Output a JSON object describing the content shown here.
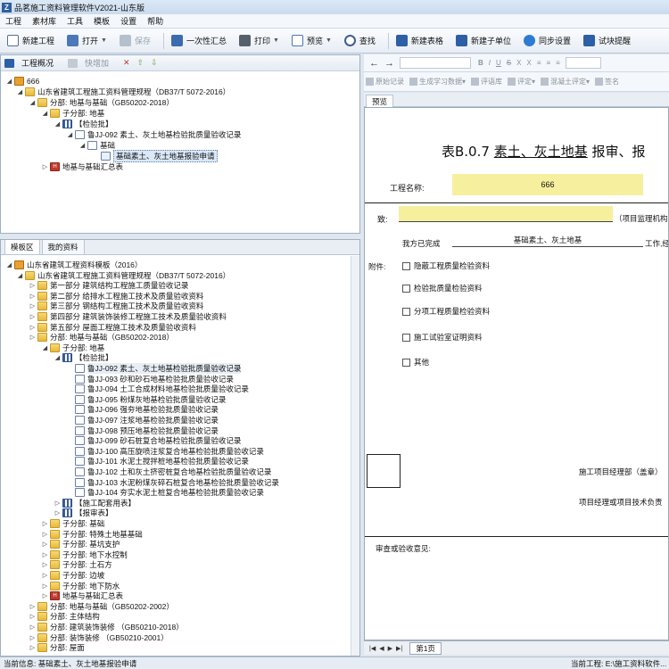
{
  "app": {
    "title": "品茗施工资料管理软件V2021-山东版"
  },
  "menu": [
    "工程",
    "素材库",
    "工具",
    "模板",
    "设置",
    "帮助"
  ],
  "toolbar": {
    "new_project": "新建工程",
    "open": "打开",
    "save": "保存",
    "summary": "一次性汇总",
    "print": "打印",
    "preview": "预览",
    "search": "查找",
    "new_table": "新建表格",
    "new_subunit": "新建子单位",
    "sync": "同步设置",
    "trial": "试块提醒"
  },
  "project_panel": {
    "title": "工程概况",
    "quick_add": "快增加",
    "tree": [
      "666",
      "山东省建筑工程施工资料管理规程（DB37/T 5072-2016）",
      "分部: 地基与基础（GB50202-2018）",
      "子分部: 地基",
      "【检验批】",
      "鲁JJ-092 素土、灰土地基检验批质量验收记录",
      "基础",
      "基础素土、灰土地基报验申请",
      "地基与基础汇总表"
    ]
  },
  "template_panel": {
    "tabs": [
      "模板区",
      "我的资料"
    ],
    "tree": [
      "山东省建筑工程资料模板（2016）",
      "山东省建筑工程施工资料管理规程（DB37/T 5072-2016）",
      "第一部分  建筑结构工程施工质量验收记录",
      "第二部分  给排水工程施工技术及质量验收资料",
      "第三部分  钢结构工程施工技术及质量验收资料",
      "第四部分  建筑装饰装修工程施工技术及质量验收资料",
      "第五部分  屋面工程施工技术及质量验收资料",
      "分部: 地基与基础（GB50202-2018）",
      "子分部: 地基",
      "【检验批】",
      "鲁JJ-092 素土、灰土地基检验批质量验收记录",
      "鲁JJ-093 砂和砂石地基检验批质量验收记录",
      "鲁JJ-094 土工合成材料地基检验批质量验收记录",
      "鲁JJ-095 粉煤灰地基检验批质量验收记录",
      "鲁JJ-096 强夯地基检验批质量验收记录",
      "鲁JJ-097 注浆地基检验批质量验收记录",
      "鲁JJ-098 预压地基检验批质量验收记录",
      "鲁JJ-099 砂石桩复合地基检验批质量验收记录",
      "鲁JJ-100 高压旋喷注浆复合地基检验批质量验收记录",
      "鲁JJ-101 水泥土搅拌桩地基检验批质量验收记录",
      "鲁JJ-102 土和灰土挤密桩复合地基检验批质量验收记录",
      "鲁JJ-103 水泥粉煤灰碎石桩复合地基检验批质量验收记录",
      "鲁JJ-104 夯实水泥土桩复合地基检验批质量验收记录",
      "【施工配套用表】",
      "【报审表】",
      "子分部: 基础",
      "子分部: 特殊土地基基础",
      "子分部: 基坑支护",
      "子分部: 地下水控制",
      "子分部: 土石方",
      "子分部: 边坡",
      "子分部: 地下防水",
      "地基与基础汇总表",
      "分部: 地基与基础（GB50202-2002）",
      "分部: 主体结构",
      "分部: 建筑装饰装修  （GB50210-2018）",
      "分部: 装饰装修  （GB50210-2001）",
      "分部: 屋面"
    ]
  },
  "doc_toolbar": {
    "items": [
      "原始记录",
      "生成学习数据",
      "评语库",
      "评定",
      "混凝土评定",
      "签名"
    ],
    "format": [
      "B",
      "I",
      "U",
      "S",
      "X",
      "X"
    ]
  },
  "doc_tabs": [
    "预览"
  ],
  "form": {
    "title_prefix": "表B.0.7",
    "title_mid": "素土、灰土地基",
    "title_suffix": "报审、报",
    "project_label": "工程名称:",
    "project_value": "666",
    "to_label": "致:",
    "to_suffix": "（项目监理机构",
    "done_label": "我方已完成",
    "done_value": "基础素土、灰土地基",
    "done_suffix": "工作,经",
    "attach_label": "附件:",
    "attachments": [
      "隐蔽工程质量检验资料",
      "检验批质量检验资料",
      "分项工程质量检验资料",
      "施工试验室证明资料",
      "其他"
    ],
    "sign_dept": "施工项目经理部（盖章）",
    "sign_manager": "项目经理或项目技术负责",
    "review_label": "审查或验收意见:"
  },
  "sheet_tab": "第1页",
  "status": {
    "left": "当前信息: 基础素土、灰土地基报验申请",
    "right": "当前工程: E:\\施工资料软件..."
  }
}
